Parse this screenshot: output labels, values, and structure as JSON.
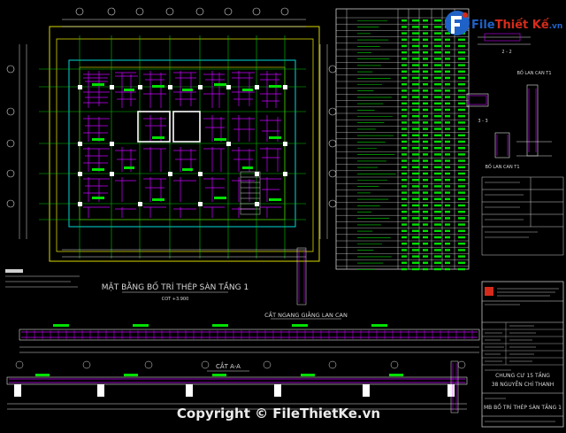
{
  "watermark": {
    "brand_part1": "File",
    "brand_part2": "Thiết Kế",
    "brand_suffix": ".vn",
    "copyright": "Copyright © FileThietKe.vn"
  },
  "plan": {
    "title": "MẶT BẰNG BỐ TRÍ THÉP SÀN TẦNG 1",
    "subtitle": "COT +3.900"
  },
  "sections": {
    "railing_title": "CẮT NGANG GIẰNG LAN CAN",
    "section_a_title": "CẮT A-A",
    "detail_1_title": "BỐ LAN CAN T1",
    "detail_2_title": "BỐ LAN CAN T1",
    "cut_2_label": "2 - 2",
    "cut_3_label": "3 - 3"
  },
  "title_block": {
    "project_line1": "CHUNG CƯ 15 TẦNG",
    "project_line2": "38 NGUYỄN CHÍ THANH",
    "drawing_name": "MB BỐ TRÍ THÉP SÀN TẦNG 1"
  },
  "colors": {
    "background": "#000000",
    "rebar": "#c800ff",
    "grid": "#00d800",
    "dims": "#e0e0e0",
    "frame": "#f0f000",
    "logo_blue": "#1f62c7",
    "logo_red": "#d62b1b"
  }
}
